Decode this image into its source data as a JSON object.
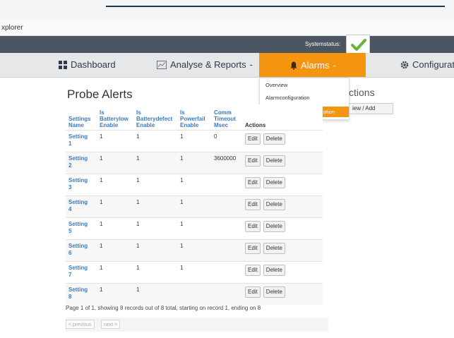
{
  "window": {
    "title": "xplorer"
  },
  "statusbar": {
    "label": "Systemstatus:"
  },
  "nav": {
    "dashboard": "Dashboard",
    "analyse": "Analyse & Reports",
    "alarms": "Alarms",
    "configuration": "Configurati"
  },
  "dropdown": {
    "items": [
      "Overview",
      "Alarmconfiguration",
      "Systemwarning Configuration"
    ]
  },
  "page": {
    "title": "Probe Alerts"
  },
  "side": {
    "title": "ctions",
    "button": "iew / Add"
  },
  "table": {
    "headers": [
      [
        "Settings",
        "Name"
      ],
      [
        "Is",
        "Batterylow",
        "Enable"
      ],
      [
        "Is",
        "Batterydefect",
        "Enable"
      ],
      [
        "Is",
        "Powerfail",
        "Enable"
      ],
      [
        "Comm",
        "Timeout",
        "Msec"
      ],
      [
        "Actions"
      ]
    ],
    "rows": [
      {
        "name1": "Setting",
        "name2": "1",
        "batterylow": "1",
        "batterydefect": "1",
        "powerfail": "1",
        "timeout": "0"
      },
      {
        "name1": "Setting",
        "name2": "2",
        "batterylow": "1",
        "batterydefect": "1",
        "powerfail": "1",
        "timeout": "3600000"
      },
      {
        "name1": "Setting",
        "name2": "3",
        "batterylow": "1",
        "batterydefect": "1",
        "powerfail": "1",
        "timeout": ""
      },
      {
        "name1": "Setting",
        "name2": "4",
        "batterylow": "1",
        "batterydefect": "1",
        "powerfail": "1",
        "timeout": ""
      },
      {
        "name1": "Setting",
        "name2": "5",
        "batterylow": "1",
        "batterydefect": "1",
        "powerfail": "1",
        "timeout": ""
      },
      {
        "name1": "Setting",
        "name2": "6",
        "batterylow": "1",
        "batterydefect": "1",
        "powerfail": "1",
        "timeout": ""
      },
      {
        "name1": "Setting",
        "name2": "7",
        "batterylow": "1",
        "batterydefect": "1",
        "powerfail": "1",
        "timeout": ""
      },
      {
        "name1": "Setting",
        "name2": "8",
        "batterylow": "1",
        "batterydefect": "1",
        "powerfail": "",
        "timeout": ""
      }
    ],
    "edit_label": "Edit",
    "delete_label": "Delete"
  },
  "footer": {
    "text": "Page 1 of 1, showing 8 records out of 8 total, starting on record 1, ending on 8"
  },
  "pager": {
    "previous": "< previous",
    "next": "next >"
  },
  "colors": {
    "accent": "#f5940f",
    "link": "#3a7bbf",
    "statusbar": "#4b5662",
    "check": "#6ab23a"
  },
  "icons": {
    "dashboard": "grid-icon",
    "analyse": "chart-icon",
    "alarms": "bell-icon",
    "configuration": "gear-icon",
    "status": "check-icon"
  }
}
